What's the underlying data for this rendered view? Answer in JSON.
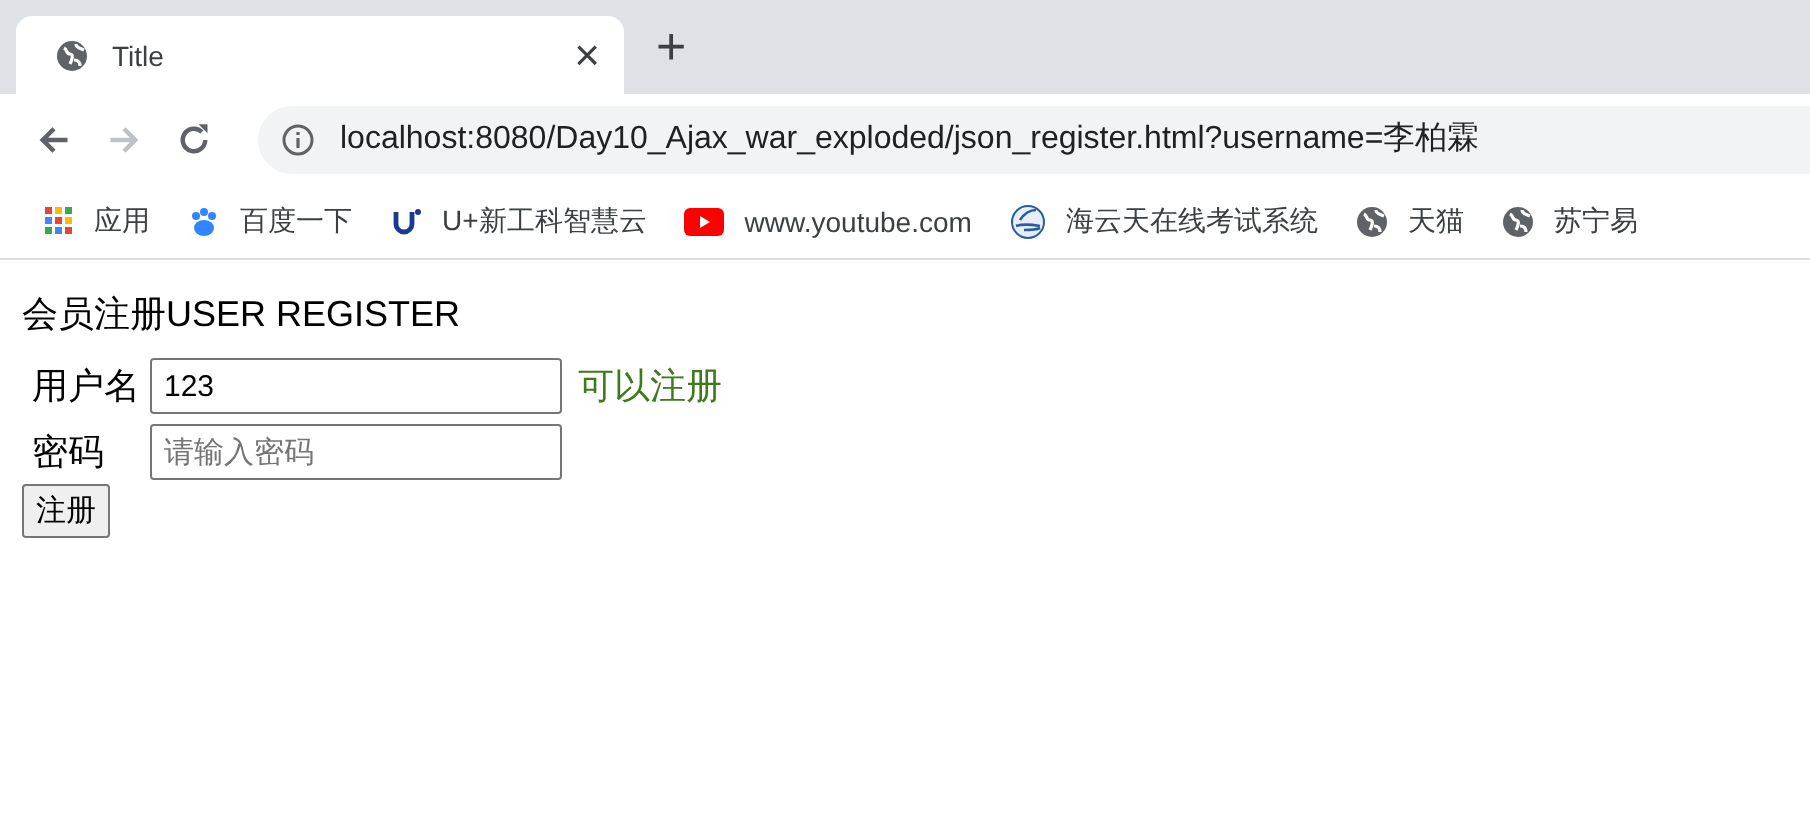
{
  "tab": {
    "title": "Title",
    "close": "×",
    "new_tab": "+"
  },
  "address_bar": {
    "url": "localhost:8080/Day10_Ajax_war_exploded/json_register.html?username=李柏霖"
  },
  "bookmarks": [
    {
      "label": "应用",
      "kind": "apps"
    },
    {
      "label": "百度一下",
      "kind": "paw"
    },
    {
      "label": "U+新工科智慧云",
      "kind": "u"
    },
    {
      "label": "www.youtube.com",
      "kind": "play"
    },
    {
      "label": "海云天在线考试系统",
      "kind": "wave"
    },
    {
      "label": "天猫",
      "kind": "globe"
    },
    {
      "label": "苏宁易",
      "kind": "globe"
    }
  ],
  "page": {
    "heading": "会员注册USER REGISTER",
    "fields": [
      {
        "label": "用户名",
        "value": "123",
        "message": "可以注册"
      },
      {
        "label": "密码",
        "placeholder": "请输入密码"
      }
    ],
    "button": "注册"
  }
}
